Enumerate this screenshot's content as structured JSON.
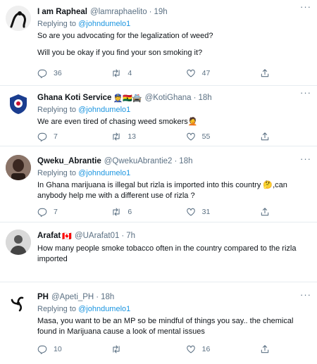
{
  "reply_prefix": "Replying to",
  "tweets": [
    {
      "name": "I am Rapheal",
      "handle": "@lamraphaelito",
      "separator": "·",
      "time": "19h",
      "reply_to": "@johndumelo1",
      "lines": [
        "So are you advocating for the legalization of weed?",
        "Will you be okay if you find your son smoking it?"
      ],
      "replies": "36",
      "retweets": "4",
      "likes": "47"
    },
    {
      "name": "Ghana Koti Service",
      "name_emoji": "👮🇬🇭🚔",
      "handle": "@KotiGhana",
      "separator": "·",
      "time": "18h",
      "reply_to": "@johndumelo1",
      "lines": [
        "We are even tired of chasing weed smokers🤦"
      ],
      "replies": "7",
      "retweets": "13",
      "likes": "55"
    },
    {
      "name": "Qweku_Abrantie",
      "handle": "@QwekuAbrantie2",
      "separator": "·",
      "time": "18h",
      "reply_to": "@johndumelo1",
      "lines": [
        "In Ghana marijuana is illegal but rizla is imported into this country 🤔,can anybody help me with a different use of rizla ?"
      ],
      "replies": "7",
      "retweets": "6",
      "likes": "31"
    },
    {
      "name": "Arafat",
      "name_emoji": "🇨🇦",
      "handle": "@UArafat01",
      "separator": "·",
      "time": "7h",
      "lines": [
        "How many people smoke tobacco often in the country compared to the rizla imported"
      ]
    },
    {
      "name": "PH",
      "handle": "@Apeti_PH",
      "separator": "·",
      "time": "18h",
      "reply_to": "@johndumelo1",
      "lines": [
        "Masa, you want to be an MP so be mindful of things you say.. the chemical found in Marijuana cause a look of mental issues"
      ],
      "replies": "10",
      "retweets": "",
      "likes": "16"
    }
  ],
  "icons": {
    "reply": "speech-bubble-icon",
    "retweet": "retweet-arrows-icon",
    "like": "heart-icon",
    "share": "share-upload-icon",
    "more": "more-dots-icon"
  },
  "colors": {
    "muted": "#5b7083",
    "link": "#1b95e0",
    "divider": "#e6ecf0"
  }
}
